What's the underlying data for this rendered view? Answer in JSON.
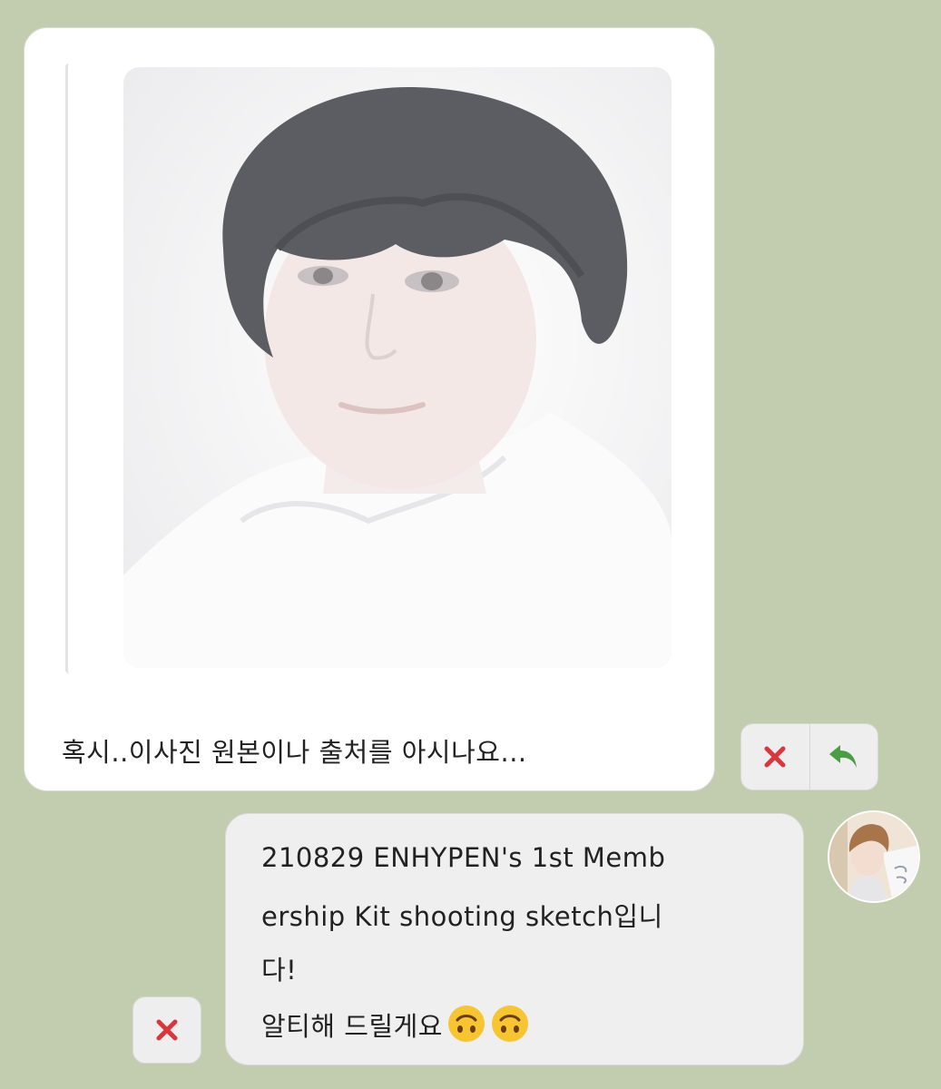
{
  "incoming": {
    "text": "혹시..이사진 원본이나 출처를 아시나요..."
  },
  "outgoing": {
    "lines": [
      "210829 ENHYPEN's 1st Memb",
      "ership Kit shooting sketch입니",
      "다!",
      "알티해 드릴게요"
    ]
  },
  "icons": {
    "delete": "close-x-icon",
    "reply": "reply-arrow-icon",
    "emoji": "upside-down-face-emoji"
  },
  "colors": {
    "background": "#c2cdb0",
    "delete_icon": "#d9363e",
    "reply_icon": "#4a9c45"
  }
}
